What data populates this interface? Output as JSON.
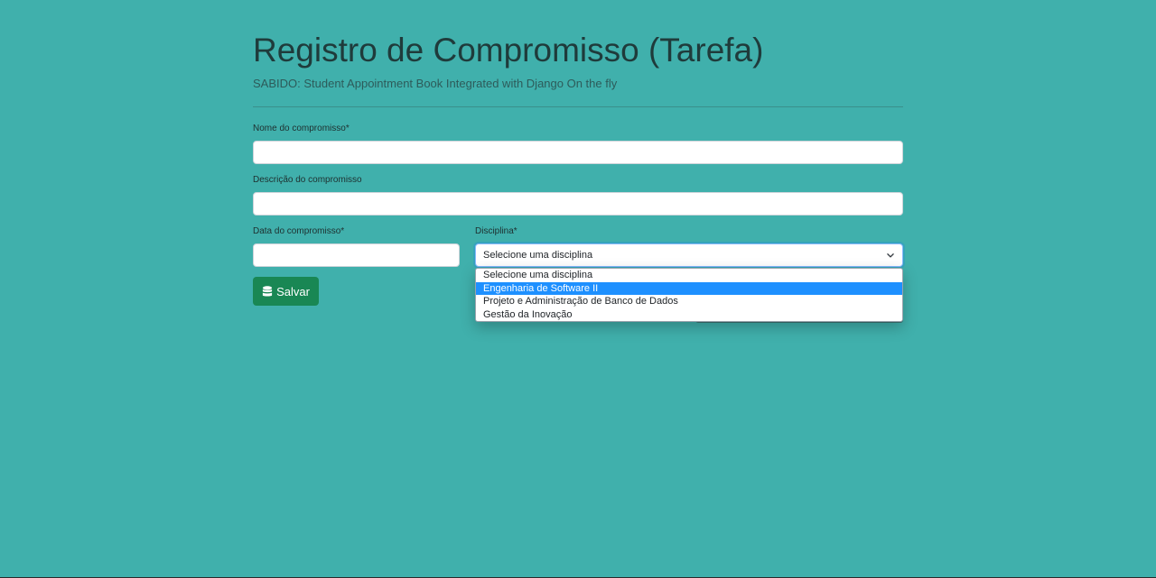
{
  "header": {
    "title": "Registro de Compromisso (Tarefa)",
    "subtitle": "SABIDO: Student Appointment Book Integrated with Django On the fly"
  },
  "form": {
    "nome": {
      "label": "Nome do compromisso*",
      "value": ""
    },
    "descricao": {
      "label": "Descrição do compromisso",
      "value": ""
    },
    "data": {
      "label": "Data do compromisso*",
      "value": ""
    },
    "disciplina": {
      "label": "Disciplina*",
      "selected": "Selecione uma disciplina",
      "icon": "chevron-down-icon",
      "options": [
        "Selecione uma disciplina",
        "Engenharia de Software II",
        "Projeto e Administração de Banco de Dados",
        "Gestão da Inovação"
      ],
      "highlighted_index": 1
    },
    "save_button": {
      "label": "Salvar",
      "icon": "database-icon"
    }
  },
  "colors": {
    "background": "#40b0ac",
    "button": "#198754",
    "highlight": "#1e90ff"
  }
}
